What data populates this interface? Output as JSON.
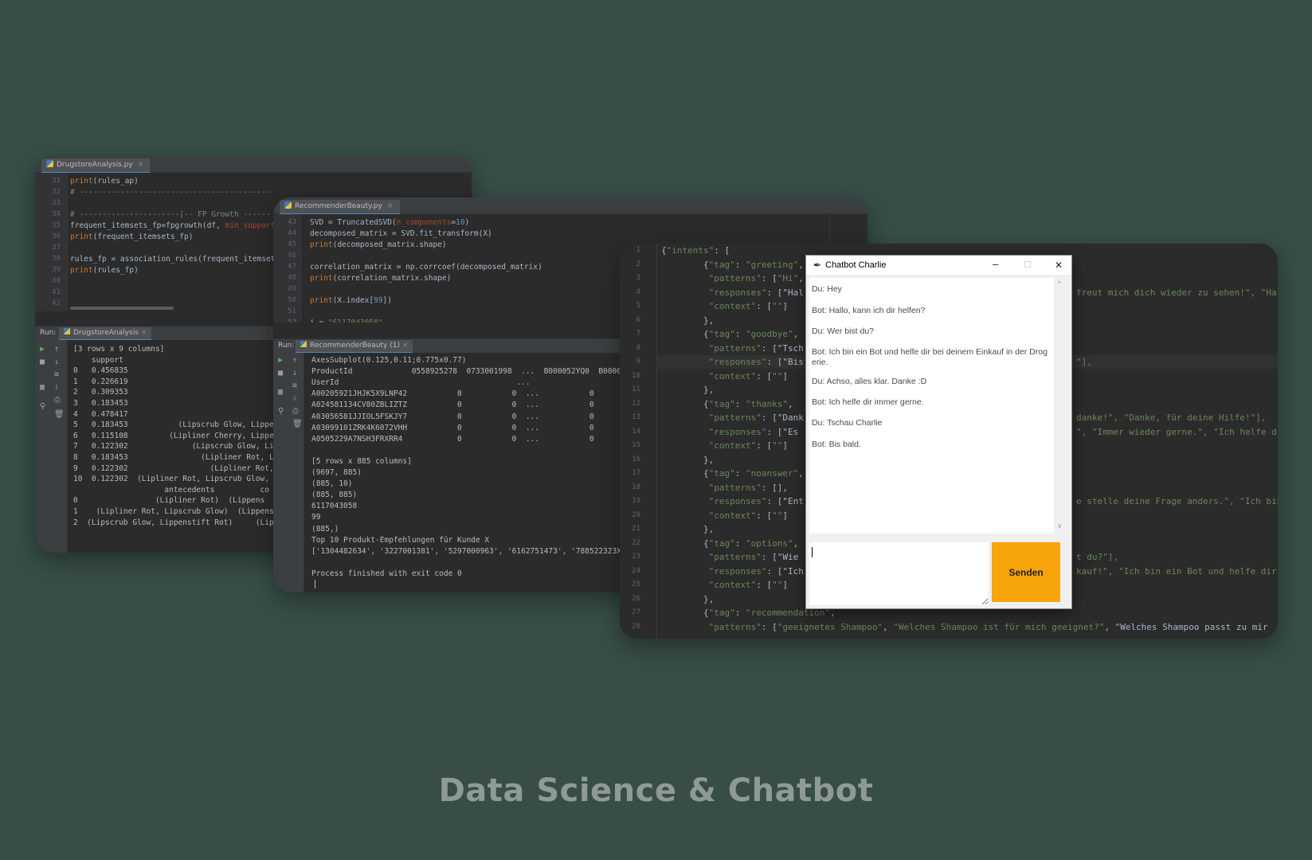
{
  "heading": "Data Science & Chatbot",
  "win1": {
    "tab": "DrugstoreAnalysis.py",
    "line_numbers": [
      "31",
      "32",
      "33",
      "34",
      "35",
      "36",
      "37",
      "38",
      "39",
      "40",
      "41",
      "42"
    ],
    "code": [
      "print(rules_ap)",
      "# ------------------------------------------",
      "",
      "# ----------------------|-- FP Growth ------",
      "frequent_itemsets_fp=fpgrowth(df, min_support=0",
      "print(frequent_itemsets_fp)",
      "",
      "rules_fp = association_rules(frequent_itemsets_",
      "print(rules_fp)",
      "",
      "",
      ""
    ],
    "run_label": "Run:",
    "run_tab": "DrugstoreAnalysis",
    "output": [
      "[3 rows x 9 columns]",
      "    support                                      (Lippe",
      "0   0.456835                                     (Lippe",
      "1   0.226619                                       (Li",
      "2   0.309353                                       (Li",
      "3   0.183453                                          ",
      "4   0.478417                                          ",
      "5   0.183453           (Lipscrub Glow, Lippe",
      "6   0.115108         (Lipliner Cherry, Lippe",
      "7   0.122302              (Lipscrub Glow, Li",
      "8   0.183453                (Lipliner Rot, Li",
      "9   0.122302                  (Lipliner Rot, ",
      "10  0.122302  (Lipliner Rot, Lipscrub Glow, L",
      "                    antecedents          co",
      "0                 (Lipliner Rot)  (Lippens",
      "1    (Lipliner Rot, Lipscrub Glow)  (Lippens",
      "2  (Lipscrub Glow, Lippenstift Rot)     (Lipl"
    ]
  },
  "win2": {
    "tab": "RecommenderBeauty.py",
    "line_numbers": [
      "43",
      "44",
      "45",
      "46",
      "47",
      "48",
      "49",
      "50",
      "51",
      "52"
    ],
    "code": [
      "SVD = TruncatedSVD(n_components=10)",
      "decomposed_matrix = SVD.fit_transform(X)",
      "print(decomposed_matrix.shape)",
      "",
      "correlation_matrix = np.corrcoef(decomposed_matrix)",
      "print(correlation_matrix.shape)",
      "",
      "print(X.index[99])",
      "",
      "i = \"6117043058\""
    ],
    "run_label": "Run:",
    "run_tab": "RecommenderBeauty (1)",
    "output": [
      "AxesSubplot(0.125,0.11;0.775x0.77)",
      "ProductId             0558925278  0733001998  ...  B000052YQ0  B00005",
      "UserId                                       ...",
      "A00205921JHJK5X9LNP42           0           0  ...           0",
      "A024581134CV80ZBLIZTZ           0           0  ...           0",
      "A03056581JJIOL5FSKJY7           0           0  ...           0",
      "A03099101ZRK4K6072VHH           0           0  ...           0",
      "A0505229A7NSH3FRXRR4            0           0  ...           0",
      "",
      "[5 rows x 885 columns]",
      "(9697, 885)",
      "(885, 10)",
      "(885, 885)",
      "6117043058",
      "99",
      "(885,)",
      "Top 10 Produkt-Empfehlungen für Kunde X",
      "['1304482634', '3227001381', '5297000963', '6162751473', '788522323X',",
      "",
      "Process finished with exit code 0"
    ]
  },
  "win3": {
    "line_numbers": [
      "1",
      "2",
      "3",
      "4",
      "5",
      "6",
      "7",
      "8",
      "9",
      "10",
      "11",
      "12",
      "13",
      "14",
      "15",
      "16",
      "17",
      "18",
      "19",
      "20",
      "21",
      "22",
      "23",
      "24",
      "25",
      "26",
      "27",
      "28"
    ],
    "left_code": [
      "{\"intents\": [",
      "        {\"tag\": \"greeting\",",
      "         \"patterns\": [\"Hi\",",
      "         \"responses\": [\"Hal",
      "         \"context\": [\"\"]",
      "        },",
      "        {\"tag\": \"goodbye\",",
      "         \"patterns\": [\"Tsch",
      "         \"responses\": [\"Bis",
      "         \"context\": [\"\"]",
      "        },",
      "        {\"tag\": \"thanks\",",
      "         \"patterns\": [\"Dank",
      "         \"responses\": [\"Es",
      "         \"context\": [\"\"]",
      "        },",
      "        {\"tag\": \"noanswer\",",
      "         \"patterns\": [],",
      "         \"responses\": [\"Ent",
      "         \"context\": [\"\"]",
      "        },",
      "        {\"tag\": \"options\",",
      "         \"patterns\": [\"Wie",
      "         \"responses\": [\"Ich",
      "         \"context\": [\"\"]",
      "        },",
      "        {\"tag\": \"recommendation\",",
      "         \"patterns\": [\"geeignetes Shampoo\", \"Welches Shampoo ist für mich geeignet?\", \"Welches Shampoo passt zu mir"
    ],
    "right_code": [
      {
        "line": 4,
        "text": "freut mich dich wieder zu sehen!\", \"Ha"
      },
      {
        "line": 9,
        "text": "\"],"
      },
      {
        "line": 13,
        "text": "danke!\", \"Danke, für deine Hilfe!\"],"
      },
      {
        "line": 14,
        "text": "\", \"Immer wieder gerne.\", \"Ich helfe di"
      },
      {
        "line": 19,
        "text": "e stelle deine Frage anders.\", \"Ich bin"
      },
      {
        "line": 23,
        "text": "t du?\"],"
      },
      {
        "line": 24,
        "text": "kauf!\", \"Ich bin ein Bot und helfe dir"
      }
    ]
  },
  "chatbot": {
    "title": "Chatbot Charlie",
    "min_btn": "–",
    "max_btn": "☐",
    "close_btn": "✕",
    "messages": [
      "Du: Hey",
      "Bot: Hallo, kann ich dir helfen?",
      "Du: Wer bist du?",
      "Bot: Ich bin ein Bot und helfe dir bei deinem Einkauf in der Drog erie.",
      "Du: Achso, alles klar. Danke :D",
      "Bot: Ich helfe dir immer gerne.",
      "Du: Tschau Charlie",
      "Bot: Bis bald."
    ],
    "input_value": "",
    "send_label": "Senden"
  }
}
